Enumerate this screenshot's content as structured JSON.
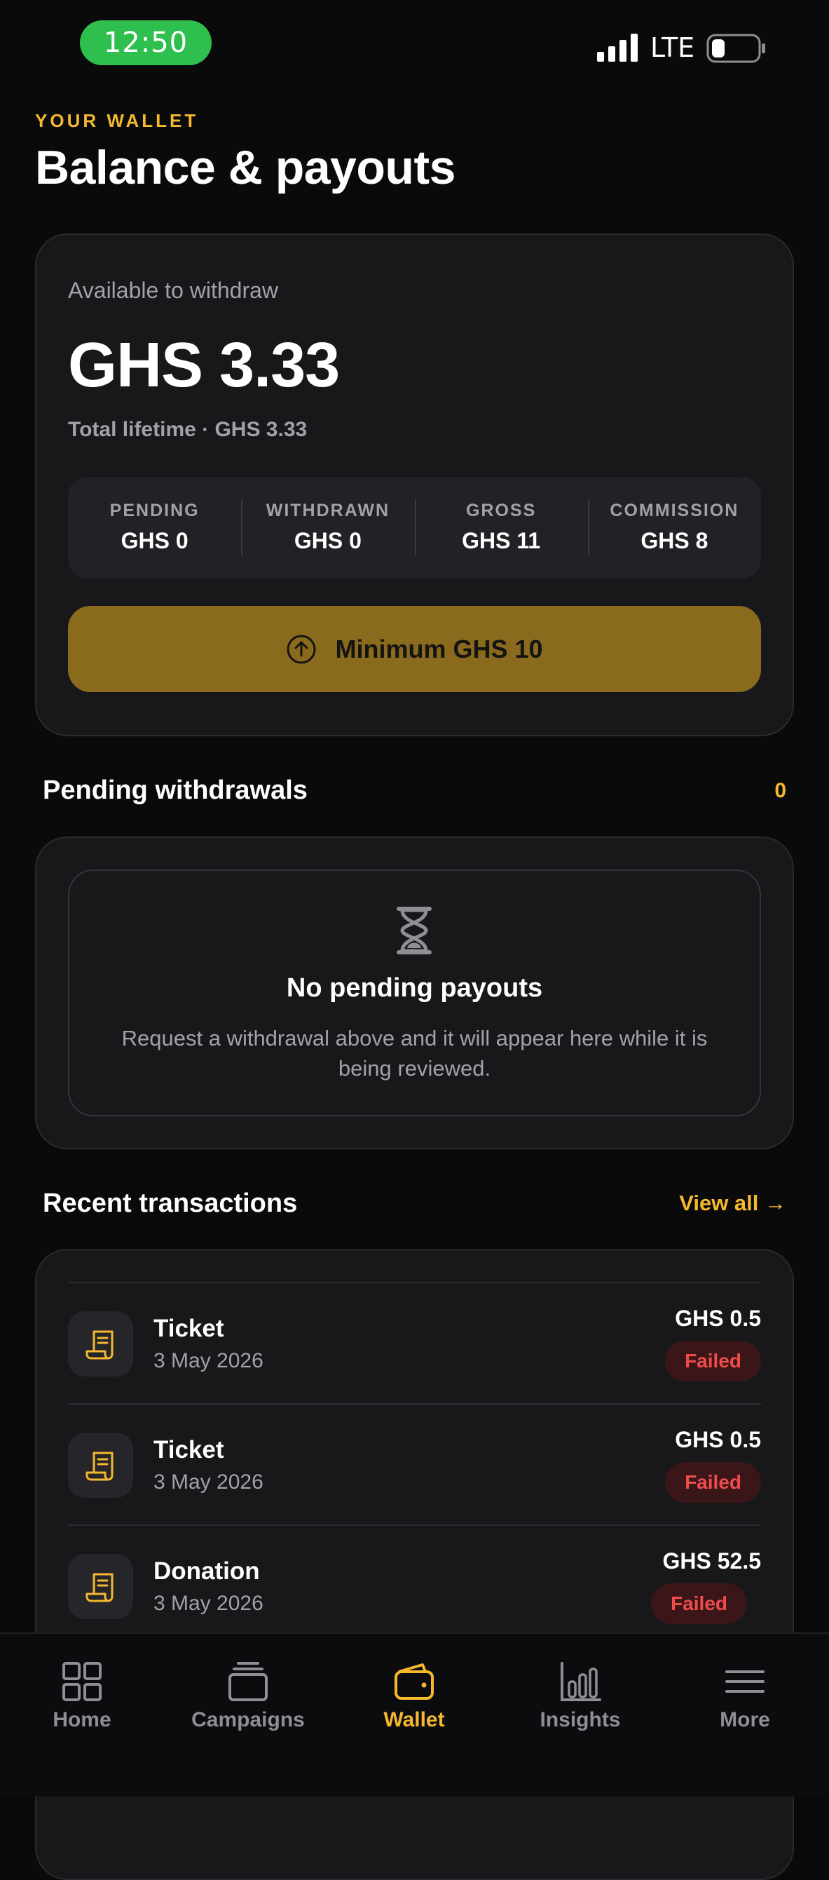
{
  "status_bar": {
    "time": "12:50",
    "network": "LTE",
    "icons": [
      "signal-icon",
      "battery-icon"
    ]
  },
  "header": {
    "eyebrow": "YOUR WALLET",
    "title": "Balance & payouts"
  },
  "balance": {
    "label": "Available to withdraw",
    "amount": "GHS 3.33",
    "lifetime": "Total lifetime · GHS 3.33",
    "stats": [
      {
        "label": "PENDING",
        "value": "GHS 0"
      },
      {
        "label": "WITHDRAWN",
        "value": "GHS 0"
      },
      {
        "label": "GROSS",
        "value": "GHS 11"
      },
      {
        "label": "COMMISSION",
        "value": "GHS 8"
      }
    ],
    "withdraw_button": "Minimum GHS 10",
    "withdraw_icon": "arrow-up-circle-icon"
  },
  "pending": {
    "title": "Pending withdrawals",
    "count": "0",
    "empty_icon": "hourglass-icon",
    "empty_title": "No pending payouts",
    "empty_description": "Request a withdrawal above and it will appear here while it is being reviewed."
  },
  "recent": {
    "title": "Recent transactions",
    "view_all": "View all →",
    "items": [
      {
        "name": "Ticket",
        "date": "3 May 2026",
        "amount": "GHS 0.5",
        "status": "Failed",
        "icon": "receipt-icon"
      },
      {
        "name": "Ticket",
        "date": "3 May 2026",
        "amount": "GHS 0.5",
        "status": "Failed",
        "icon": "receipt-icon"
      },
      {
        "name": "Donation",
        "date": "3 May 2026",
        "amount": "GHS 52.5",
        "status": "Failed",
        "icon": "receipt-icon"
      }
    ]
  },
  "nav": {
    "items": [
      {
        "label": "Home",
        "icon": "grid-icon",
        "active": false
      },
      {
        "label": "Campaigns",
        "icon": "stack-icon",
        "active": false
      },
      {
        "label": "Wallet",
        "icon": "wallet-icon",
        "active": true
      },
      {
        "label": "Insights",
        "icon": "bar-chart-icon",
        "active": false
      },
      {
        "label": "More",
        "icon": "menu-icon",
        "active": false
      }
    ]
  },
  "colors": {
    "accent": "#f5b82e",
    "button": "#8a6a1c",
    "failed_text": "#ef4b4b",
    "failed_bg": "#3a1619",
    "status_pill": "#2fbf4f"
  }
}
